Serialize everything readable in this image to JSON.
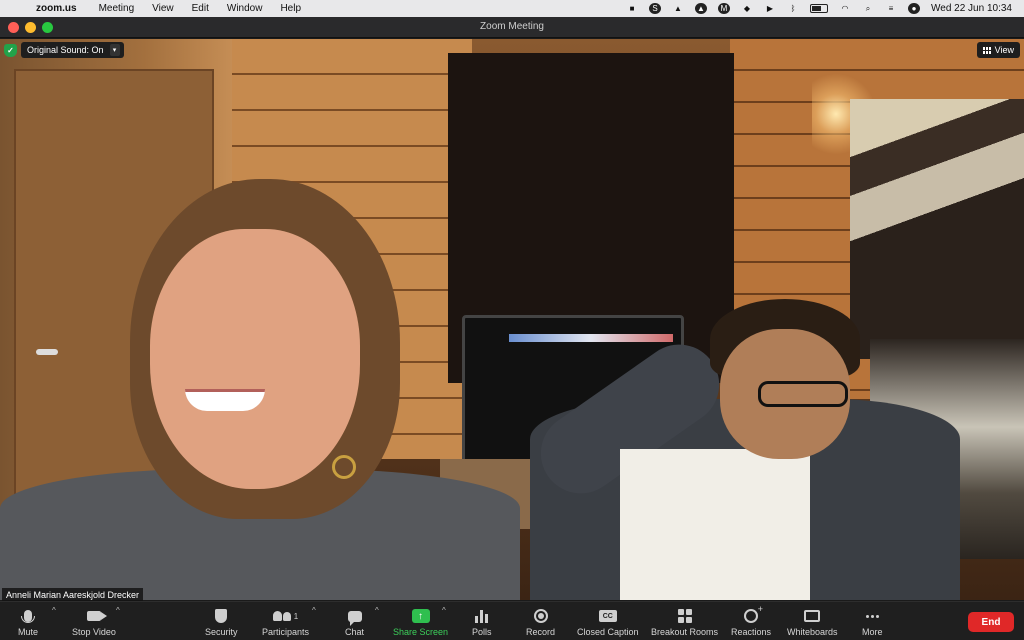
{
  "menubar": {
    "app_name": "zoom.us",
    "items": [
      "Meeting",
      "View",
      "Edit",
      "Window",
      "Help"
    ],
    "datetime": "Wed 22 Jun  10:34"
  },
  "window": {
    "title": "Zoom Meeting"
  },
  "overlay": {
    "original_sound": "Original Sound: On",
    "view_label": "View",
    "participant_name": "Anneli Marian Aareskjold Drecker"
  },
  "toolbar": {
    "mute": "Mute",
    "stop_video": "Stop Video",
    "security": "Security",
    "participants": "Participants",
    "participant_count": "1",
    "chat": "Chat",
    "share_screen": "Share Screen",
    "polls": "Polls",
    "record": "Record",
    "closed_caption": "Closed Caption",
    "cc_badge": "CC",
    "breakout_rooms": "Breakout Rooms",
    "reactions": "Reactions",
    "whiteboards": "Whiteboards",
    "more": "More",
    "end": "End"
  },
  "colors": {
    "share_green": "#2fbf4f",
    "end_red": "#e02828",
    "toolbar_bg": "#1f1f1f"
  }
}
